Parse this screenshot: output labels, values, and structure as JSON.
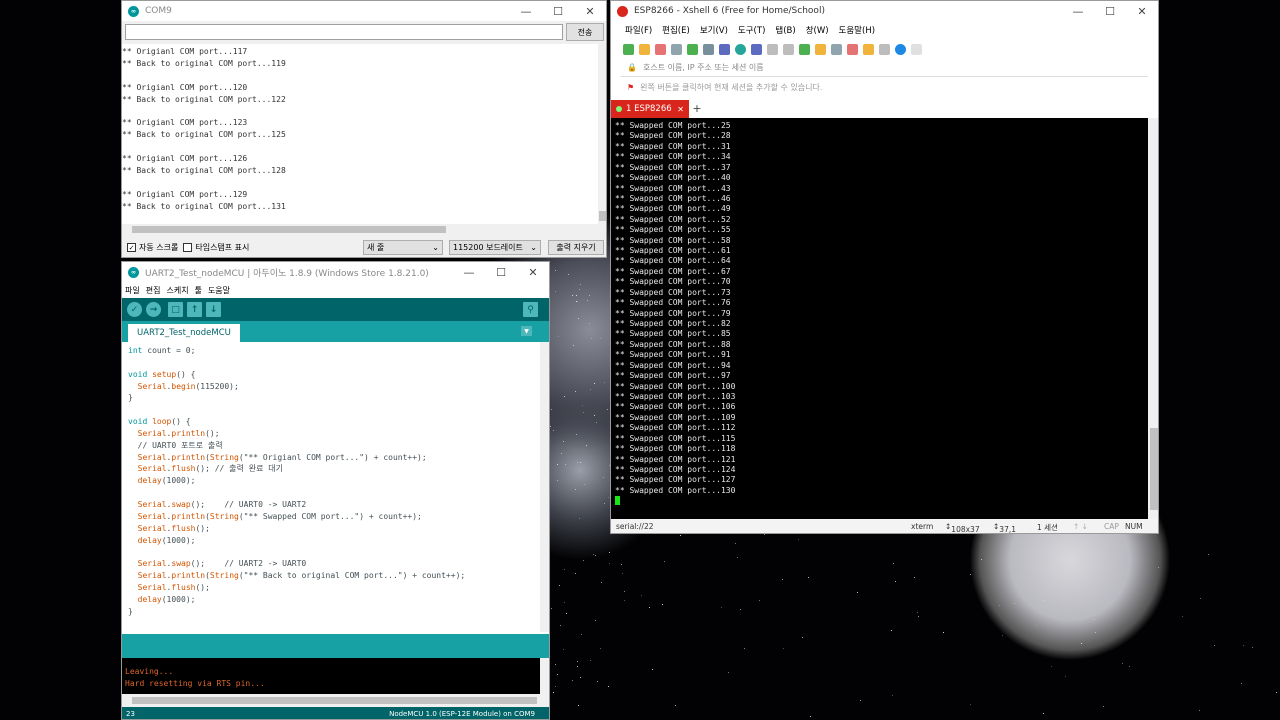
{
  "com9": {
    "title": "COM9",
    "send_label": "전송",
    "output_lines": [
      "** Origianl COM port...117",
      "** Back to original COM port...119",
      "",
      "** Origianl COM port...120",
      "** Back to original COM port...122",
      "",
      "** Origianl COM port...123",
      "** Back to original COM port...125",
      "",
      "** Origianl COM port...126",
      "** Back to original COM port...128",
      "",
      "** Origianl COM port...129",
      "** Back to original COM port...131"
    ],
    "autoscroll_label": "자동 스크롤",
    "autoscroll_checked": true,
    "timestamp_label": "타임스탬프 표시",
    "line_ending": "새 줄",
    "baud_rate": "115200 보드레이트",
    "clear_label": "출력 지우기"
  },
  "arduino": {
    "title": "UART2_Test_nodeMCU | 아두이노 1.8.9 (Windows Store 1.8.21.0)",
    "menu": [
      "파일",
      "편집",
      "스케치",
      "툴",
      "도움말"
    ],
    "tab": "UART2_Test_nodeMCU",
    "code_lines": [
      "int count = 0;",
      "",
      "void setup() {",
      "  Serial.begin(115200);",
      "}",
      "",
      "void loop() {",
      "  Serial.println();",
      "  // UART0 포트로 출력",
      "  Serial.println(String(\"** Origianl COM port...\") + count++);",
      "  Serial.flush(); // 출력 완료 대기",
      "  delay(1000);",
      "",
      "  Serial.swap();    // UART0 -> UART2",
      "  Serial.println(String(\"** Swapped COM port...\") + count++);",
      "  Serial.flush();",
      "  delay(1000);",
      "",
      "  Serial.swap();    // UART2 -> UART0",
      "  Serial.println(String(\"** Back to original COM port...\") + count++);",
      "  Serial.flush();",
      "  delay(1000);",
      "}"
    ],
    "console_lines": [
      "Leaving...",
      "Hard resetting via RTS pin..."
    ],
    "line_number": "23",
    "board": "NodeMCU 1.0 (ESP-12E Module) on COM9"
  },
  "xshell": {
    "title": "ESP8266 - Xshell 6 (Free for Home/School)",
    "menu": [
      "파일(F)",
      "편집(E)",
      "보기(V)",
      "도구(T)",
      "탭(B)",
      "창(W)",
      "도움말(H)"
    ],
    "address_placeholder": "호스트 이름, IP 주소 또는 세션 이름",
    "hint": "왼쪽 버튼을 클릭하여 현재 세션을 추가할 수 있습니다.",
    "tab_label": "1 ESP8266",
    "terminal_lines": [
      "** Swapped COM port...25",
      "** Swapped COM port...28",
      "** Swapped COM port...31",
      "** Swapped COM port...34",
      "** Swapped COM port...37",
      "** Swapped COM port...40",
      "** Swapped COM port...43",
      "** Swapped COM port...46",
      "** Swapped COM port...49",
      "** Swapped COM port...52",
      "** Swapped COM port...55",
      "** Swapped COM port...58",
      "** Swapped COM port...61",
      "** Swapped COM port...64",
      "** Swapped COM port...67",
      "** Swapped COM port...70",
      "** Swapped COM port...73",
      "** Swapped COM port...76",
      "** Swapped COM port...79",
      "** Swapped COM port...82",
      "** Swapped COM port...85",
      "** Swapped COM port...88",
      "** Swapped COM port...91",
      "** Swapped COM port...94",
      "** Swapped COM port...97",
      "** Swapped COM port...100",
      "** Swapped COM port...103",
      "** Swapped COM port...106",
      "** Swapped COM port...109",
      "** Swapped COM port...112",
      "** Swapped COM port...115",
      "** Swapped COM port...118",
      "** Swapped COM port...121",
      "** Swapped COM port...124",
      "** Swapped COM port...127",
      "** Swapped COM port...130"
    ],
    "status": {
      "session": "serial://22",
      "term": "xterm",
      "size": "108x37",
      "position": "37,1",
      "sessions": "1 세션",
      "caps": "CAP",
      "num": "NUM"
    }
  },
  "colors": {
    "arduino_teal_dark": "#006468",
    "arduino_teal": "#17a1a5",
    "xshell_tab_red": "#d9261c",
    "cursor_green": "#19e619"
  }
}
